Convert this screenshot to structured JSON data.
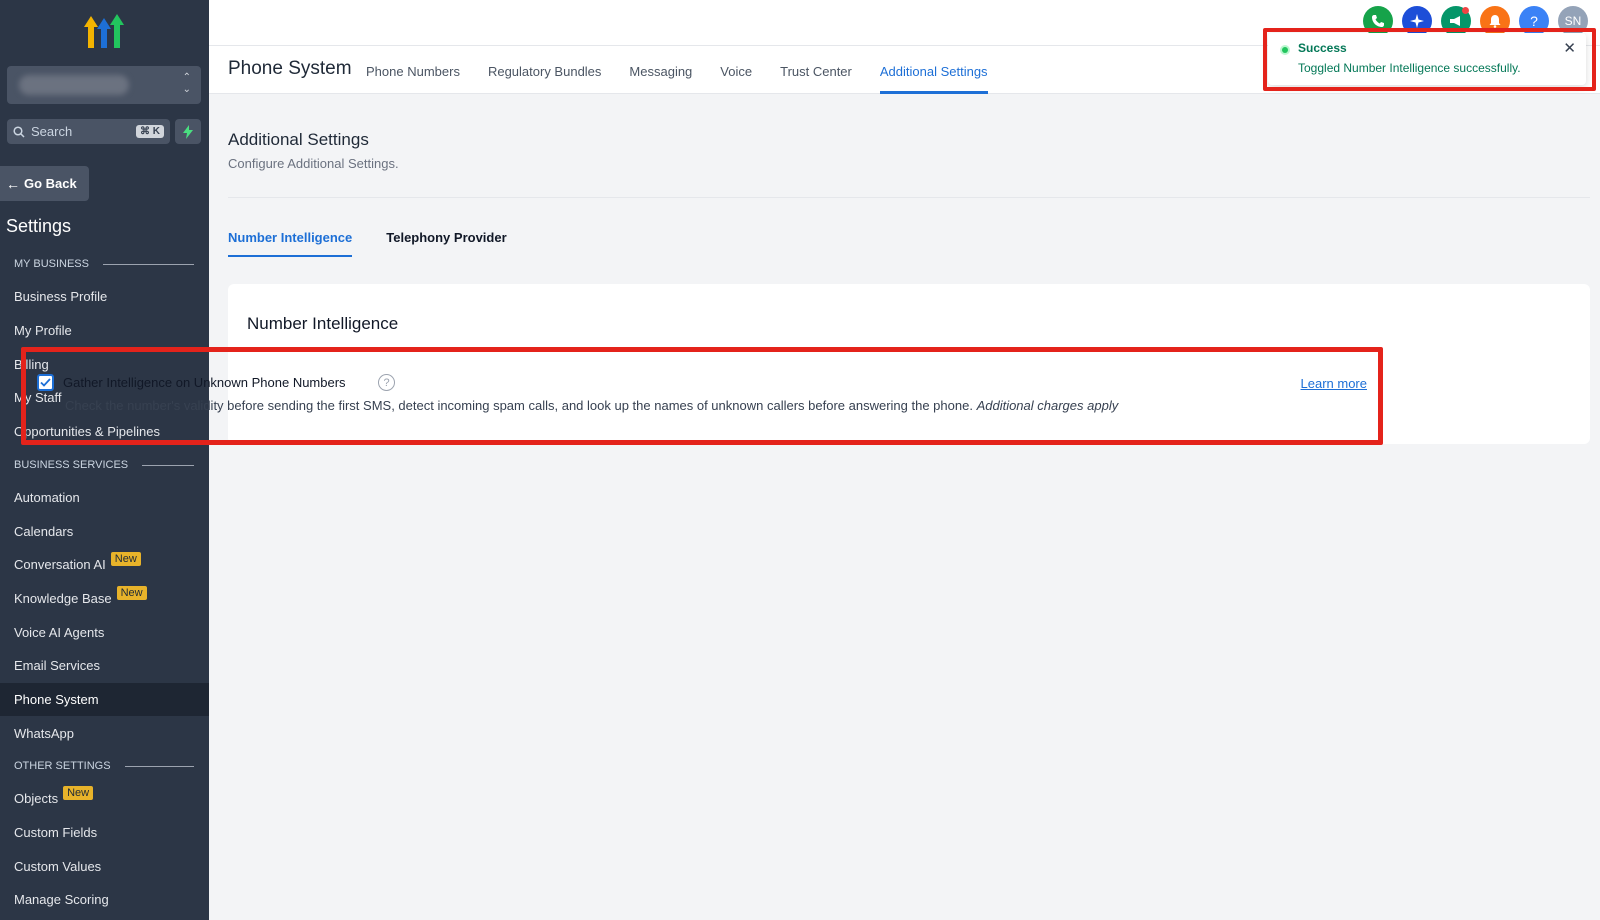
{
  "sidebar": {
    "search_placeholder": "Search",
    "search_shortcut": "⌘ K",
    "go_back": "Go Back",
    "title": "Settings",
    "sections": {
      "my_business": "MY BUSINESS",
      "business_services": "BUSINESS SERVICES",
      "other_settings": "OTHER SETTINGS"
    },
    "items": [
      {
        "label": "Business Profile"
      },
      {
        "label": "My Profile"
      },
      {
        "label": "Billing"
      },
      {
        "label": "My Staff"
      },
      {
        "label": "Opportunities & Pipelines"
      },
      {
        "label": "Automation"
      },
      {
        "label": "Calendars"
      },
      {
        "label": "Conversation AI",
        "badge": "New"
      },
      {
        "label": "Knowledge Base",
        "badge": "New"
      },
      {
        "label": "Voice AI Agents"
      },
      {
        "label": "Email Services"
      },
      {
        "label": "Phone System",
        "active": true
      },
      {
        "label": "WhatsApp"
      },
      {
        "label": "Objects",
        "badge": "New"
      },
      {
        "label": "Custom Fields"
      },
      {
        "label": "Custom Values"
      },
      {
        "label": "Manage Scoring"
      }
    ]
  },
  "header": {
    "title": "Phone System",
    "tabs": [
      "Phone Numbers",
      "Regulatory Bundles",
      "Messaging",
      "Voice",
      "Trust Center",
      "Additional Settings"
    ],
    "active_tab": "Additional Settings",
    "avatar_initials": "SN",
    "help_label": "?"
  },
  "toast": {
    "title": "Success",
    "message": "Toggled Number Intelligence successfully."
  },
  "main": {
    "title": "Additional Settings",
    "subtitle": "Configure Additional Settings.",
    "subtabs": [
      "Number Intelligence",
      "Telephony Provider"
    ],
    "card": {
      "title": "Number Intelligence",
      "setting_label": "Gather Intelligence on Unknown Phone Numbers",
      "setting_checked": true,
      "description": "Check the number's validity before sending the first SMS, detect incoming spam calls, and look up the names of unknown callers before answering the phone.",
      "description_note": "Additional charges apply",
      "learn_more": "Learn more"
    }
  },
  "colors": {
    "sidebar_bg": "#2c3646",
    "accent": "#1d6fd6",
    "highlight": "#e4231b",
    "badge": "#e8b32a",
    "success": "#047857"
  }
}
